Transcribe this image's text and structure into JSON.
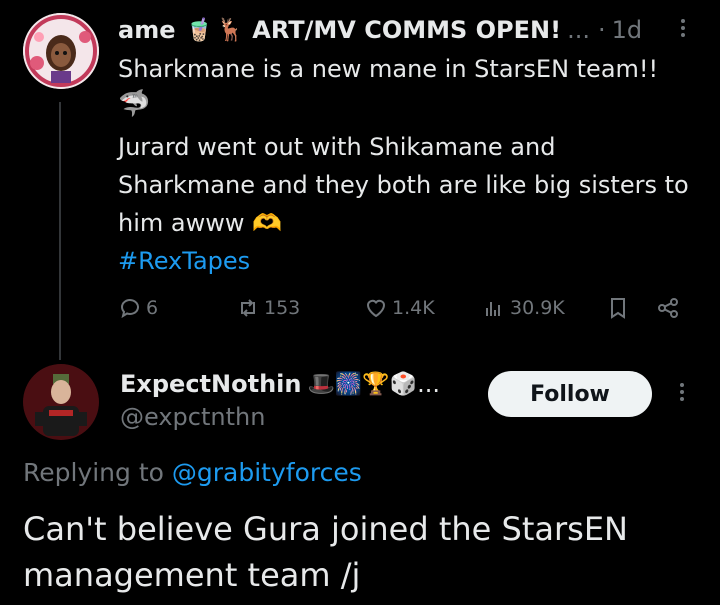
{
  "post1": {
    "author_name": "ame",
    "author_emojis": [
      "🧋",
      "🦌"
    ],
    "author_suffix": "ART/MV COMMS OPEN!",
    "ellipsis": "...",
    "dot": "·",
    "age": "1d",
    "line1": "Sharkmane is a new mane in StarsEN team!!",
    "shark_emoji": "🦈",
    "paragraph2": "Jurard went out with Shikamane and Sharkmane and they both are like big sisters to him awww 🫶",
    "hashtag": "#RexTapes",
    "replies": "6",
    "reposts": "153",
    "likes": "1.4K",
    "views": "30.9K"
  },
  "post2": {
    "author_name": "ExpectNothin",
    "author_emojis": "🎩🎆🏆🎲",
    "author_ellipsis": "...",
    "handle": "@expctnthn",
    "follow_label": "Follow",
    "replying_prefix": "Replying to ",
    "replying_to": "@grabityforces",
    "text": "Can't believe Gura joined the StarsEN management team /j"
  },
  "colors": {
    "background": "#000000",
    "text": "#e7e9ea",
    "muted": "#71767b",
    "link": "#1d9bf0",
    "follow_bg": "#eff3f4"
  }
}
